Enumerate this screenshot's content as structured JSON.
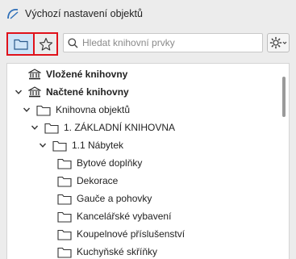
{
  "window": {
    "title": "Výchozí nastavení objektů",
    "app_icon": "archicad-arc-icon"
  },
  "toolbar": {
    "folder_mode_icon": "folder-icon",
    "favorites_mode_icon": "star-icon",
    "search_placeholder": "Hledat knihovní prvky",
    "search_value": "",
    "settings_icon": "gear-dropdown-icon"
  },
  "colors": {
    "highlight_border": "#e0121b",
    "selected_mode_bg": "#cfe4f7"
  },
  "tree": {
    "items": [
      {
        "label": "Vložené knihovny",
        "bold": true,
        "icon": "library-building-icon",
        "expanded": null
      },
      {
        "label": "Načtené knihovny",
        "bold": true,
        "icon": "library-building-icon",
        "expanded": true
      },
      {
        "label": "Knihovna objektů",
        "bold": false,
        "icon": "folder-icon",
        "expanded": true
      },
      {
        "label": "1. ZÁKLADNÍ KNIHOVNA",
        "bold": false,
        "icon": "folder-icon",
        "expanded": true
      },
      {
        "label": "1.1 Nábytek",
        "bold": false,
        "icon": "folder-icon",
        "expanded": true
      },
      {
        "label": "Bytové doplňky",
        "bold": false,
        "icon": "folder-icon",
        "expanded": null
      },
      {
        "label": "Dekorace",
        "bold": false,
        "icon": "folder-icon",
        "expanded": null
      },
      {
        "label": "Gauče a pohovky",
        "bold": false,
        "icon": "folder-icon",
        "expanded": null
      },
      {
        "label": "Kancelářské vybavení",
        "bold": false,
        "icon": "folder-icon",
        "expanded": null
      },
      {
        "label": "Koupelnové příslušenství",
        "bold": false,
        "icon": "folder-icon",
        "expanded": null
      },
      {
        "label": "Kuchyňské skříňky",
        "bold": false,
        "icon": "folder-icon",
        "expanded": null
      }
    ]
  }
}
